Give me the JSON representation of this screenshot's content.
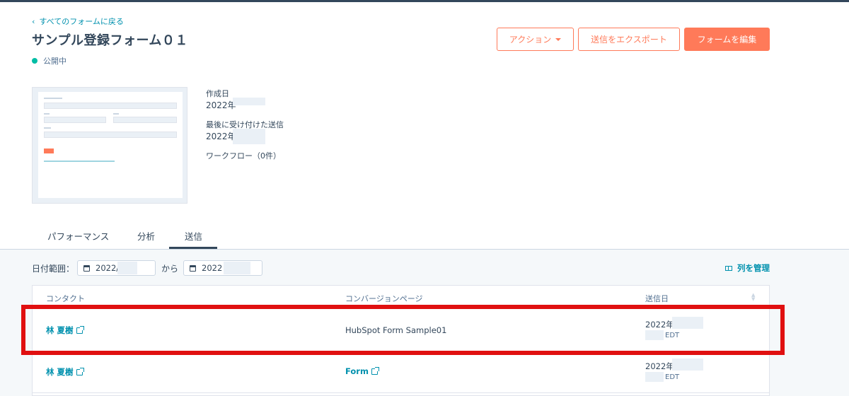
{
  "header": {
    "back_label": "すべてのフォームに戻る",
    "title": "サンプル登録フォーム０１",
    "status": "公開中",
    "status_color": "#00bda5"
  },
  "actions": {
    "action_label": "アクション",
    "export_label": "送信をエクスポート",
    "edit_label": "フォームを編集",
    "accent": "#ff7a59"
  },
  "meta": {
    "created_label": "作成日",
    "created_value": "2022年",
    "last_received_label": "最後に受け付けた送信",
    "last_received_value": "2022年",
    "workflow_label": "ワークフロー（0件）"
  },
  "tabs": [
    {
      "label": "パフォーマンス",
      "active": false
    },
    {
      "label": "分析",
      "active": false
    },
    {
      "label": "送信",
      "active": true
    }
  ],
  "filter": {
    "date_range_label": "日付範囲：",
    "from_value": "2022/",
    "to_label": "から",
    "to_value": "2022",
    "manage_columns_label": "列を管理"
  },
  "table": {
    "columns": [
      "コンタクト",
      "コンバージョンページ",
      "送信日"
    ],
    "rows": [
      {
        "contact": "林 夏樹",
        "page": "HubSpot Form Sample01",
        "page_is_link": false,
        "date": "2022年",
        "tz": "EDT",
        "highlighted": true
      },
      {
        "contact": "林 夏樹",
        "page": "Form",
        "page_is_link": true,
        "date": "2022年",
        "tz": "EDT",
        "highlighted": false
      }
    ]
  }
}
